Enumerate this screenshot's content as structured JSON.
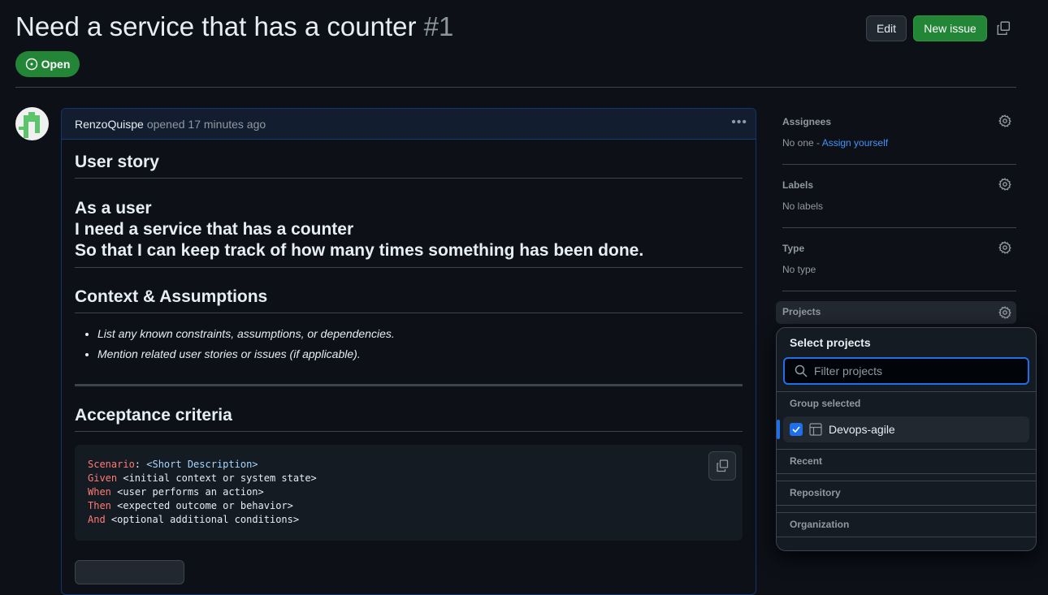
{
  "issue": {
    "title": "Need a service that has a counter",
    "number": "#1",
    "state": "Open",
    "author": "RenzoQuispe",
    "opened": "opened 17 minutes ago"
  },
  "toolbar": {
    "edit": "Edit",
    "new_issue": "New issue"
  },
  "body": {
    "h_story": "User story",
    "story": [
      "As a user",
      "I need a service that has a counter",
      "So that I can keep track of how many times something has been done."
    ],
    "h_context": "Context & Assumptions",
    "context": [
      "List any known constraints, assumptions, or dependencies.",
      "Mention related user stories or issues (if applicable)."
    ],
    "h_accept": "Acceptance criteria",
    "code": [
      {
        "kw": "Scenario",
        "sep": ": ",
        "rest": "<Short Description>"
      },
      {
        "kw": "Given",
        "sep": " ",
        "rest": "<initial context or system state>"
      },
      {
        "kw": "When",
        "sep": " ",
        "rest": "<user performs an action>"
      },
      {
        "kw": "Then",
        "sep": " ",
        "rest": "<expected outcome or behavior>"
      },
      {
        "kw": "And",
        "sep": " ",
        "rest": "<optional additional conditions>"
      }
    ]
  },
  "sidebar": {
    "assignees": "Assignees",
    "assignees_val": "No one - ",
    "assign_link": "Assign yourself",
    "labels": "Labels",
    "labels_val": "No labels",
    "type": "Type",
    "type_val": "No type",
    "projects": "Projects"
  },
  "dropdown": {
    "title": "Select projects",
    "placeholder": "Filter projects",
    "group_selected": "Group selected",
    "project": "Devops-agile",
    "recent": "Recent",
    "repository": "Repository",
    "organization": "Organization"
  }
}
